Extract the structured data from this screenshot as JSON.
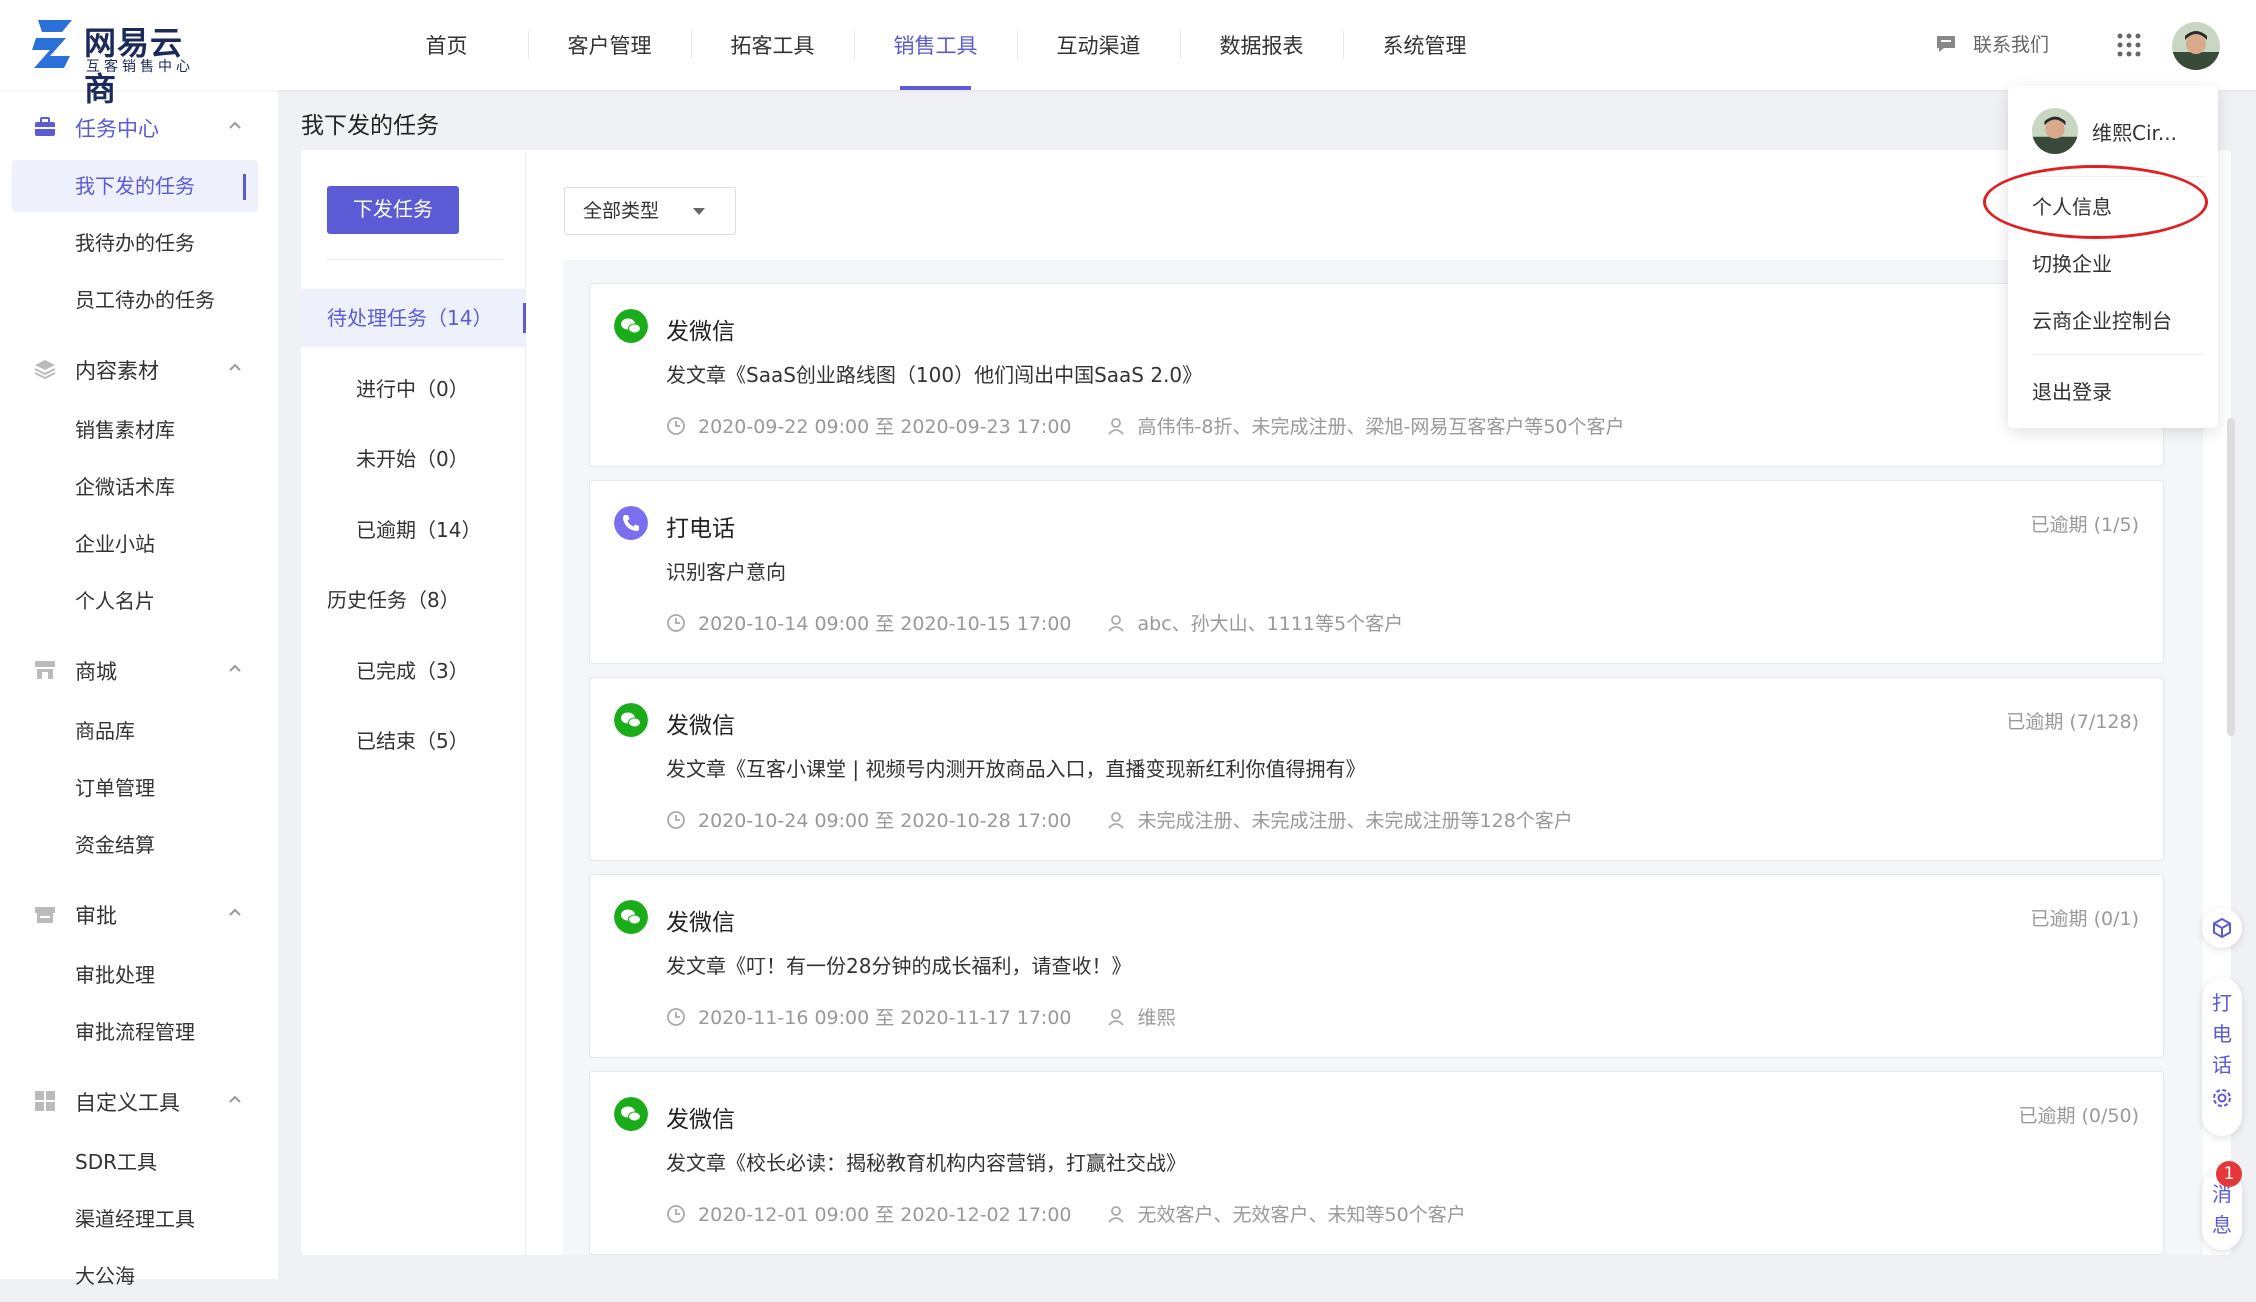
{
  "brand": {
    "title": "网易云商",
    "subtitle": "互客销售中心"
  },
  "nav": [
    {
      "label": "首页",
      "active": false
    },
    {
      "label": "客户管理",
      "active": false
    },
    {
      "label": "拓客工具",
      "active": false
    },
    {
      "label": "销售工具",
      "active": true
    },
    {
      "label": "互动渠道",
      "active": false
    },
    {
      "label": "数据报表",
      "active": false
    },
    {
      "label": "系统管理",
      "active": false
    }
  ],
  "header": {
    "contact_label": "联系我们"
  },
  "sidebar": {
    "groups": [
      {
        "label": "任务中心",
        "icon": "briefcase-icon",
        "items": [
          "我下发的任务",
          "我待办的任务",
          "员工待办的任务"
        ]
      },
      {
        "label": "内容素材",
        "icon": "layers-icon",
        "items": [
          "销售素材库",
          "企微话术库",
          "企业小站",
          "个人名片"
        ]
      },
      {
        "label": "商城",
        "icon": "shop-icon",
        "items": [
          "商品库",
          "订单管理",
          "资金结算"
        ]
      },
      {
        "label": "审批",
        "icon": "stamp-icon",
        "items": [
          "审批处理",
          "审批流程管理"
        ]
      },
      {
        "label": "自定义工具",
        "icon": "grid-icon",
        "items": [
          "SDR工具",
          "渠道经理工具",
          "大公海"
        ]
      }
    ],
    "active_item": "我下发的任务"
  },
  "page": {
    "title": "我下发的任务",
    "issue_button": "下发任务",
    "filter_value": "全部类型"
  },
  "status_menu": [
    {
      "label": "待处理任务（14）",
      "active": true,
      "indent": false
    },
    {
      "label": "进行中（0）",
      "active": false,
      "indent": true
    },
    {
      "label": "未开始（0）",
      "active": false,
      "indent": true
    },
    {
      "label": "已逾期（14）",
      "active": false,
      "indent": true
    },
    {
      "label": "历史任务（8）",
      "active": false,
      "indent": false
    },
    {
      "label": "已完成（3）",
      "active": false,
      "indent": true
    },
    {
      "label": "已结束（5）",
      "active": false,
      "indent": true
    }
  ],
  "tasks": [
    {
      "type": "发微信",
      "icon": "wechat-icon",
      "status": "",
      "desc": "发文章《SaaS创业路线图（100）他们闯出中国SaaS 2.0》",
      "time": "2020-09-22 09:00 至 2020-09-23 17:00",
      "customers": "高伟伟-8折、未完成注册、梁旭-网易互客客户等50个客户"
    },
    {
      "type": "打电话",
      "icon": "phone-icon",
      "status": "已逾期 (1/5)",
      "desc": "识别客户意向",
      "time": "2020-10-14 09:00 至 2020-10-15 17:00",
      "customers": "abc、孙大山、1111等5个客户"
    },
    {
      "type": "发微信",
      "icon": "wechat-icon",
      "status": "已逾期 (7/128)",
      "desc": "发文章《互客小课堂 | 视频号内测开放商品入口，直播变现新红利你值得拥有》",
      "time": "2020-10-24 09:00 至 2020-10-28 17:00",
      "customers": "未完成注册、未完成注册、未完成注册等128个客户"
    },
    {
      "type": "发微信",
      "icon": "wechat-icon",
      "status": "已逾期 (0/1)",
      "desc": "发文章《叮！有一份28分钟的成长福利，请查收！》",
      "time": "2020-11-16 09:00 至 2020-11-17 17:00",
      "customers": "维熙"
    },
    {
      "type": "发微信",
      "icon": "wechat-icon",
      "status": "已逾期 (0/50)",
      "desc": "发文章《校长必读：揭秘教育机构内容营销，打赢社交战》",
      "time": "2020-12-01 09:00 至 2020-12-02 17:00",
      "customers": "无效客户、无效客户、未知等50个客户"
    }
  ],
  "user_menu": {
    "username": "维熙Cir...",
    "items": [
      "个人信息",
      "切换企业",
      "云商企业控制台",
      "退出登录"
    ]
  },
  "float_tools": {
    "call_label": "打电话",
    "message_label": "消息",
    "message_badge": "1"
  },
  "colors": {
    "accent": "#5b5bd6",
    "wechat": "#1aad19",
    "phone": "#7b6ff0",
    "highlight_ring": "#e02020"
  }
}
